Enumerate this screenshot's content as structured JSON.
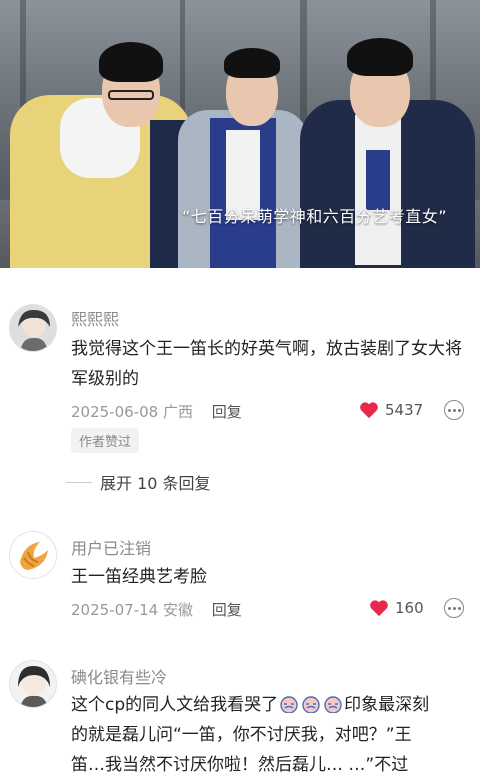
{
  "video": {
    "caption": "“七百分呆萌学神和六百分艺考直女”"
  },
  "comments": [
    {
      "username": "熙熙熙",
      "avatar": "anime-avatar",
      "text": "我觉得这个王一笛长的好英气啊，放古装剧了女大将军级别的",
      "date": "2025-06-08",
      "location": "广西",
      "reply_label": "回复",
      "likes": "5437",
      "badge": "作者赞过",
      "expand_label": "展开 10 条回复"
    },
    {
      "username": "用户已注销",
      "avatar": "croissant-avatar",
      "text": "王一笛经典艺考脸",
      "date": "2025-07-14",
      "location": "安徽",
      "reply_label": "回复",
      "likes": "160"
    },
    {
      "username": "碘化银有些冷",
      "avatar": "anime-avatar",
      "text_line1_before": "这个cp的同人文给我看哭了",
      "text_line1_after": "印象最深刻",
      "text_line2": "的就是磊儿问“一笛，你不讨厌我，对吧？”王",
      "text_line3": "笛…我当然不讨厌你啦！然后磊儿…  …”不过"
    }
  ],
  "colors": {
    "heart": "#e8264e",
    "meta": "#999999",
    "username": "#8a8a8a"
  }
}
